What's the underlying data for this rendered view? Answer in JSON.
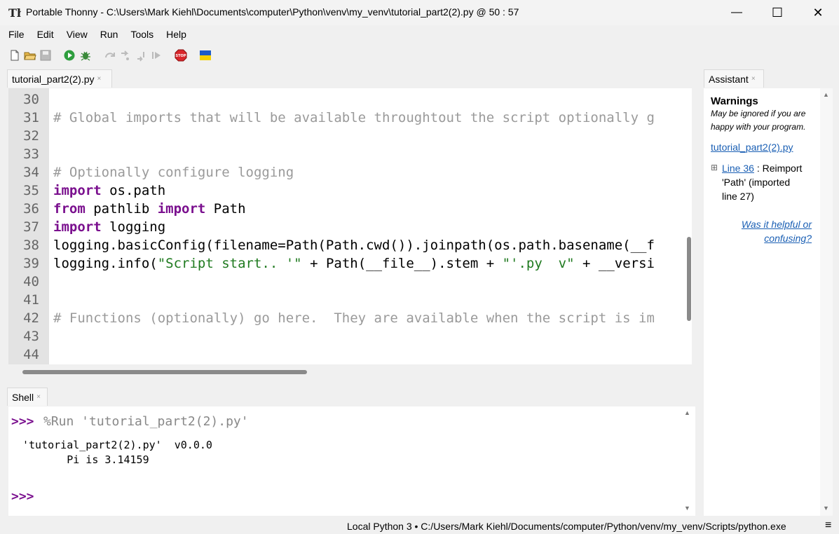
{
  "window": {
    "title": "Portable Thonny  -  C:\\Users\\Mark Kiehl\\Documents\\computer\\Python\\venv\\my_venv\\tutorial_part2(2).py  @  50 : 57",
    "minimize": "—",
    "maximize": "☐",
    "close": "✕"
  },
  "menu": [
    "File",
    "Edit",
    "View",
    "Run",
    "Tools",
    "Help"
  ],
  "toolbar": {
    "icons": [
      "new-file-icon",
      "open-file-icon",
      "save-icon",
      "run-icon",
      "debug-icon",
      "step-over-icon",
      "step-into-icon",
      "step-out-icon",
      "resume-icon",
      "stop-icon",
      "ukraine-flag-icon"
    ],
    "stop_label": "STOP"
  },
  "editor": {
    "tab_label": "tutorial_part2(2).py",
    "tab_close": "×",
    "lines": [
      {
        "num": "30",
        "segments": []
      },
      {
        "num": "31",
        "segments": [
          {
            "t": "# Global imports that will be available throughtout the script optionally g",
            "c": "cm"
          }
        ]
      },
      {
        "num": "32",
        "segments": []
      },
      {
        "num": "33",
        "segments": []
      },
      {
        "num": "34",
        "segments": [
          {
            "t": "# Optionally configure logging",
            "c": "cm"
          }
        ]
      },
      {
        "num": "35",
        "segments": [
          {
            "t": "import",
            "c": "kw"
          },
          {
            "t": " os.path",
            "c": ""
          }
        ]
      },
      {
        "num": "36",
        "segments": [
          {
            "t": "from",
            "c": "kw"
          },
          {
            "t": " pathlib ",
            "c": ""
          },
          {
            "t": "import",
            "c": "kw"
          },
          {
            "t": " Path",
            "c": ""
          }
        ]
      },
      {
        "num": "37",
        "segments": [
          {
            "t": "import",
            "c": "kw"
          },
          {
            "t": " logging",
            "c": ""
          }
        ]
      },
      {
        "num": "38",
        "segments": [
          {
            "t": "logging.basicConfig(filename=Path(Path.cwd()).joinpath(os.path.basename(__f",
            "c": ""
          }
        ]
      },
      {
        "num": "39",
        "segments": [
          {
            "t": "logging.info(",
            "c": ""
          },
          {
            "t": "\"Script start.. '\"",
            "c": "st"
          },
          {
            "t": " + Path(__file__).stem + ",
            "c": ""
          },
          {
            "t": "\"'.py  v\"",
            "c": "st"
          },
          {
            "t": " + __versi",
            "c": ""
          }
        ]
      },
      {
        "num": "40",
        "segments": []
      },
      {
        "num": "41",
        "segments": []
      },
      {
        "num": "42",
        "segments": [
          {
            "t": "# Functions (optionally) go here.  They are available when the script is im",
            "c": "cm"
          }
        ]
      },
      {
        "num": "43",
        "segments": []
      },
      {
        "num": "44",
        "segments": []
      }
    ]
  },
  "shell": {
    "tab_label": "Shell",
    "tab_close": "×",
    "prompt": ">>>",
    "run_command": "%Run 'tutorial_part2(2).py'",
    "output_line1": "'tutorial_part2(2).py'  v0.0.0",
    "output_line2": "       Pi is 3.14159",
    "prompt2": ">>>"
  },
  "assistant": {
    "tab_label": "Assistant",
    "tab_close": "×",
    "heading": "Warnings",
    "note_line1": "May be ignored if you are",
    "note_line2": "happy with your program.",
    "file_link": "tutorial_part2(2).py",
    "expand_icon": "⊞",
    "warning_link": "Line 36",
    "warning_text1": " : Reimport",
    "warning_text2": "'Path' (imported",
    "warning_text3": "line 27)",
    "feedback_line1": "Was it helpful or",
    "feedback_line2": "confusing?"
  },
  "statusbar": {
    "text": "Local Python 3  •  C:/Users/Mark Kiehl/Documents/computer/Python/venv/my_venv/Scripts/python.exe",
    "menu_icon": "≡"
  }
}
